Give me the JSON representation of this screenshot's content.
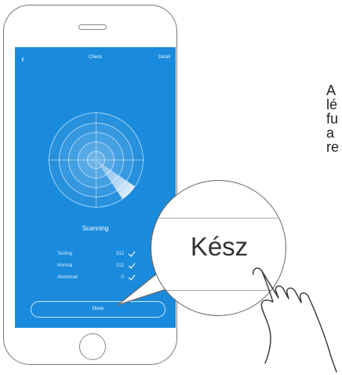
{
  "header": {
    "back_icon": "‹",
    "title": "Check",
    "detail": "Detail"
  },
  "scan": {
    "status": "Scanning"
  },
  "stats": [
    {
      "label": "Testing",
      "value": "312"
    },
    {
      "label": "Normal",
      "value": "312"
    },
    {
      "label": "Abnormal",
      "value": "0"
    }
  ],
  "done_label": "Done",
  "zoom_label": "Kész",
  "side_text": [
    "A",
    "lé",
    "fu",
    "a",
    "re"
  ],
  "icons": {
    "back": "chevron-left-icon",
    "check": "check-icon",
    "radar": "radar-icon",
    "hand": "pointing-hand-icon"
  },
  "colors": {
    "screen": "#1a8bdc",
    "radar_ring": "#ffffff"
  }
}
